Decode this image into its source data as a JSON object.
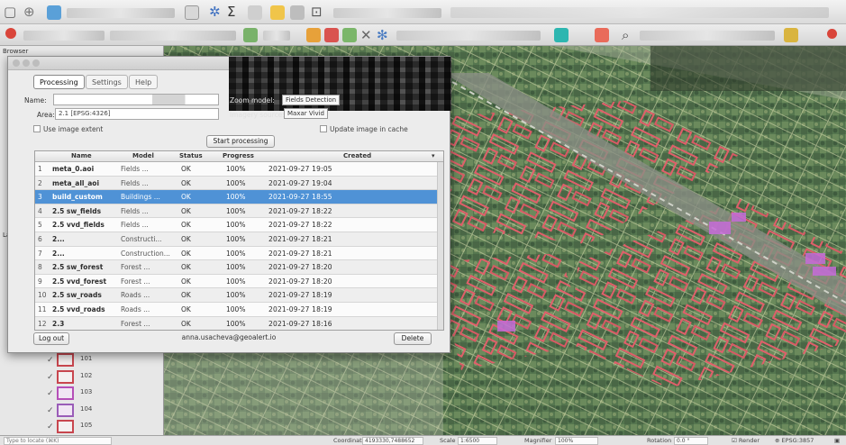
{
  "left_panel": {
    "browser_title": "Browser",
    "layers_title": "Laye",
    "legend": [
      {
        "label": "101",
        "fill": "#f4f0f0",
        "border": "#c8464e"
      },
      {
        "label": "102",
        "fill": "#f4f0f0",
        "border": "#c8464e"
      },
      {
        "label": "103",
        "fill": "#f1e6f4",
        "border": "#b54fb8"
      },
      {
        "label": "104",
        "fill": "#f1e6f4",
        "border": "#9a5cb8"
      },
      {
        "label": "105",
        "fill": "#f4f0f0",
        "border": "#c8464e"
      }
    ]
  },
  "dialog": {
    "tabs": [
      "Processing",
      "Settings",
      "Help"
    ],
    "name_label": "Name:",
    "area_label": "Area:",
    "area_value": "2.1 [EPSG:4326]",
    "use_image_extent": "Use image extent",
    "zoom_label": "Zoom model:",
    "zoom_value": "Fields Detection",
    "imagery_label": "Imagery source:",
    "imagery_value": "Maxar Vivid",
    "update_cache_label": "Update image in cache",
    "start_button": "Start processing",
    "columns": [
      "Name",
      "Model",
      "Status",
      "Progress",
      "Created"
    ],
    "rows": [
      {
        "num": "1",
        "name": "meta_0.aoi",
        "model": "Fields ...",
        "status": "OK",
        "progress": "100%",
        "created": "2021-09-27 19:05"
      },
      {
        "num": "2",
        "name": "meta_all_aoi",
        "model": "Fields ...",
        "status": "OK",
        "progress": "100%",
        "created": "2021-09-27 19:04"
      },
      {
        "num": "3",
        "name": "build_custom",
        "model": "Buildings ...",
        "status": "OK",
        "progress": "100%",
        "created": "2021-09-27 18:55"
      },
      {
        "num": "4",
        "name": "2.5 sw_fields",
        "model": "Fields ...",
        "status": "OK",
        "progress": "100%",
        "created": "2021-09-27 18:22"
      },
      {
        "num": "5",
        "name": "2.5 vvd_fields",
        "model": "Fields ...",
        "status": "OK",
        "progress": "100%",
        "created": "2021-09-27 18:22"
      },
      {
        "num": "6",
        "name": "2...",
        "model": "Constructi...",
        "status": "OK",
        "progress": "100%",
        "created": "2021-09-27 18:21"
      },
      {
        "num": "7",
        "name": "2...",
        "model": "Construction...",
        "status": "OK",
        "progress": "100%",
        "created": "2021-09-27 18:21"
      },
      {
        "num": "8",
        "name": "2.5 sw_forest",
        "model": "Forest ...",
        "status": "OK",
        "progress": "100%",
        "created": "2021-09-27 18:20"
      },
      {
        "num": "9",
        "name": "2.5 vvd_forest",
        "model": "Forest ...",
        "status": "OK",
        "progress": "100%",
        "created": "2021-09-27 18:20"
      },
      {
        "num": "10",
        "name": "2.5 sw_roads",
        "model": "Roads ...",
        "status": "OK",
        "progress": "100%",
        "created": "2021-09-27 18:19"
      },
      {
        "num": "11",
        "name": "2.5 vvd_roads",
        "model": "Roads ...",
        "status": "OK",
        "progress": "100%",
        "created": "2021-09-27 18:19"
      },
      {
        "num": "12",
        "name": "2.3",
        "model": "Forest ...",
        "status": "OK",
        "progress": "100%",
        "created": "2021-09-27 18:16"
      }
    ],
    "selected_row": 2,
    "logout_button": "Log out",
    "user_email": "anna.usacheva@geoalert.io",
    "delete_button": "Delete"
  },
  "status_bar": {
    "locator": "Type to locate (⌘K)",
    "coordinate_label": "Coordinate",
    "coordinate_value": "4193330,7488652",
    "scale_label": "Scale",
    "scale_value": "1:6500",
    "magnifier_label": "Magnifier",
    "magnifier_value": "100%",
    "rotation_label": "Rotation",
    "rotation_value": "0.0 °",
    "render_label": "Render",
    "crs_value": "EPSG:3857"
  }
}
